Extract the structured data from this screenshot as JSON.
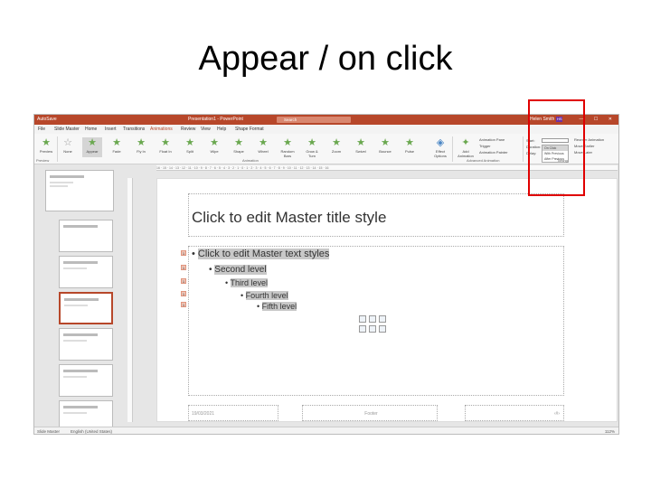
{
  "slide_title": "Appear / on click",
  "app": {
    "quick_access": "AutoSave",
    "document_name": "Presentation1 - PowerPoint",
    "search_placeholder": "Search",
    "user_name": "Helen Smith",
    "user_badge": "HS",
    "window_controls": "— ☐ ✕"
  },
  "tabs": [
    "File",
    "Slide Master",
    "Home",
    "Insert",
    "Transitions",
    "Animations",
    "Review",
    "View",
    "Help",
    "Shape Format"
  ],
  "active_tab": "Animations",
  "ribbon": {
    "preview": "Preview",
    "animations": [
      "None",
      "Appear",
      "Fade",
      "Fly In",
      "Float In",
      "Split",
      "Wipe",
      "Shape",
      "Wheel",
      "Random Bars",
      "Grow & Turn",
      "Zoom",
      "Swivel",
      "Bounce",
      "Pulse"
    ],
    "effect_options": "Effect Options",
    "add_animation": "Add Animation",
    "animation_pane": "Animation Pane",
    "trigger": "Trigger",
    "animation_painter": "Animation Painter",
    "start_label": "Start:",
    "duration_label": "Duration:",
    "delay_label": "Delay:",
    "start_options": [
      "On Click",
      "With Previous",
      "After Previous"
    ],
    "reorder_title": "Reorder Animation",
    "move_earlier": "Move Earlier",
    "move_later": "Move Later",
    "groups": [
      "Preview",
      "Animation",
      "Advanced Animation",
      "Timing"
    ]
  },
  "ruler": "16 · 15 · 14 · 13 · 12 · 11 · 10 · 9 · 8 · 7 · 6 · 5 · 4 · 3 · 2 · 1 · 0 · 1 · 2 · 3 · 4 · 5 · 6 · 7 · 8 · 9 · 10 · 11 · 12 · 13 · 14 · 15 · 16",
  "master": {
    "title": "Click to edit Master title style",
    "levels": [
      "Click to edit Master text styles",
      "Second level",
      "Third level",
      "Fourth level",
      "Fifth level"
    ],
    "anim_tags": [
      "1",
      "1",
      "1",
      "1",
      "1"
    ],
    "date": "19/03/2021",
    "footer": "Footer",
    "slide_number": "‹#›"
  },
  "statusbar": {
    "view": "Slide Master",
    "language": "English (United States)",
    "zoom": "112%"
  }
}
